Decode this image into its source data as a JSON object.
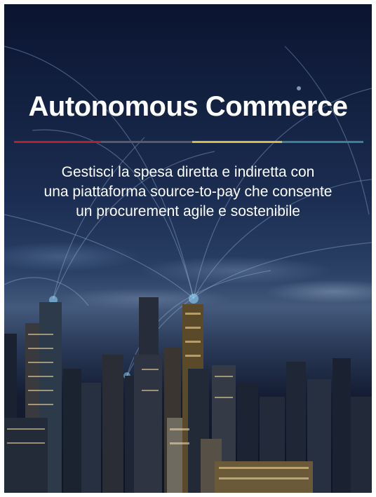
{
  "banner": {
    "title": "Autonomous Commerce",
    "subtitle": "Gestisci la spesa diretta e indiretta con\nuna piattaforma source-to-pay che consente\nun procurement agile e sostenibile",
    "stripe_colors": [
      "#b5202f",
      "#5a5a66",
      "#d6b94a",
      "#3f7f95"
    ]
  }
}
